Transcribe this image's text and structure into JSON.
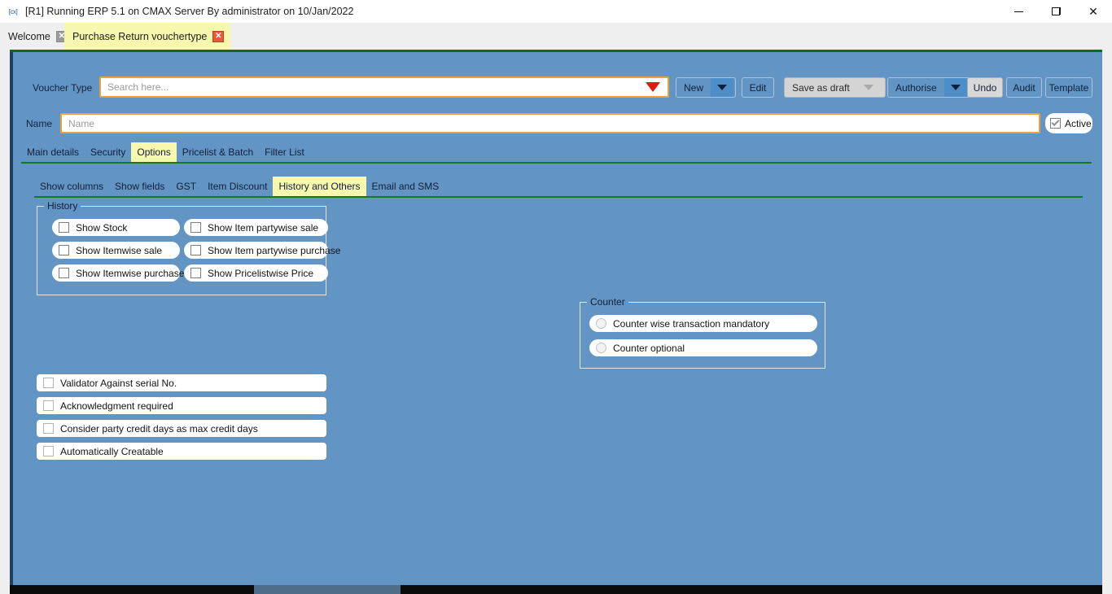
{
  "window": {
    "title": "[R1] Running ERP 5.1 on CMAX Server By administrator on 10/Jan/2022",
    "app_icon": "cx-icon",
    "minimize_label": "–",
    "maximize_label": "❐",
    "close_label": "✕"
  },
  "tabs": {
    "items": [
      {
        "label": "Welcome",
        "active": false,
        "close": "✕"
      },
      {
        "label": "Purchase Return vouchertype",
        "active": true,
        "close": "✕"
      }
    ],
    "add_tab_label": "+"
  },
  "form": {
    "voucher_type": {
      "label": "Voucher Type",
      "placeholder": "Search here...",
      "value": "",
      "dropdown_icon": "dropdown-arrow-red"
    },
    "name": {
      "label": "Name",
      "placeholder": "Name",
      "value": ""
    },
    "active": {
      "label": "Active",
      "checked": true
    }
  },
  "toolbar": {
    "buttons": [
      {
        "name": "new",
        "label": "New",
        "type": "split",
        "state": "normal"
      },
      {
        "name": "edit",
        "label": "Edit",
        "type": "plain",
        "state": "normal"
      },
      {
        "name": "save-as-draft",
        "label": "Save as draft",
        "type": "split",
        "state": "disabled"
      },
      {
        "name": "authorise",
        "label": "Authorise",
        "type": "split",
        "state": "normal"
      },
      {
        "name": "undo",
        "label": "Undo",
        "type": "plain",
        "state": "grey"
      },
      {
        "name": "audit",
        "label": "Audit",
        "type": "plain",
        "state": "normal"
      },
      {
        "name": "template",
        "label": "Template",
        "type": "plain",
        "state": "normal"
      }
    ]
  },
  "primary_tabs": {
    "items": [
      {
        "label": "Main details",
        "selected": false
      },
      {
        "label": "Security",
        "selected": false
      },
      {
        "label": "Options",
        "selected": true
      },
      {
        "label": "Pricelist & Batch",
        "selected": false
      },
      {
        "label": "Filter List",
        "selected": false
      }
    ]
  },
  "secondary_tabs": {
    "items": [
      {
        "label": "Show columns",
        "selected": false
      },
      {
        "label": "Show fields",
        "selected": false
      },
      {
        "label": "GST",
        "selected": false
      },
      {
        "label": "Item Discount",
        "selected": false
      },
      {
        "label": "History and Others",
        "selected": true
      },
      {
        "label": "Email and SMS",
        "selected": false
      }
    ]
  },
  "history_group": {
    "title": "History",
    "left_column": [
      {
        "label": "Show Stock",
        "checked": false
      },
      {
        "label": "Show Itemwise sale",
        "checked": false
      },
      {
        "label": "Show Itemwise purchase",
        "checked": false
      }
    ],
    "right_column": [
      {
        "label": "Show Item partywise sale",
        "checked": false
      },
      {
        "label": "Show Item partywise purchase",
        "checked": false
      },
      {
        "label": "Show Pricelistwise Price",
        "checked": false
      }
    ]
  },
  "counter_group": {
    "title": "Counter",
    "options": [
      {
        "label": "Counter wise transaction mandatory",
        "selected": false
      },
      {
        "label": "Counter optional",
        "selected": false
      }
    ]
  },
  "other_options": [
    {
      "label": "Validator Against serial No.",
      "checked": false
    },
    {
      "label": "Acknowledgment required",
      "checked": false
    },
    {
      "label": "Consider party credit days as max credit days",
      "checked": false
    },
    {
      "label": "Automatically Creatable",
      "checked": false
    }
  ],
  "colors": {
    "canvas": "#6294c4",
    "accent_green": "#117a29",
    "highlight_yellow": "#f7f7ad",
    "field_border_orange": "#e8a33d",
    "dropdown_red": "#e01b12"
  }
}
